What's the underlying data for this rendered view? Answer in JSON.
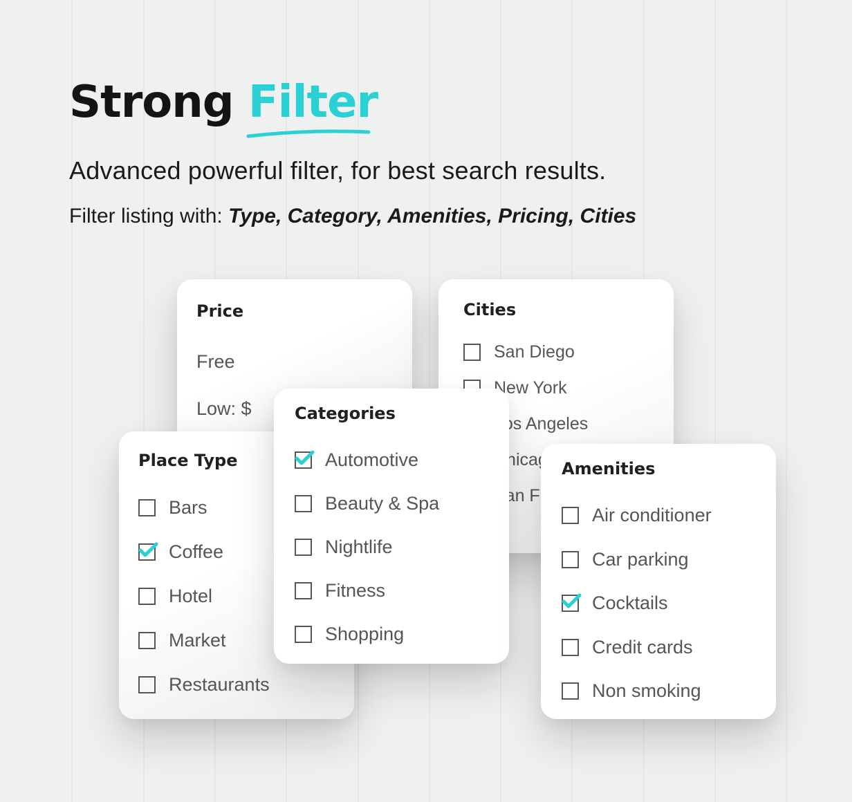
{
  "header": {
    "title_primary": "Strong",
    "title_accent": "Filter",
    "subtitle": "Advanced powerful filter, for best search results.",
    "filter_prefix": "Filter listing with: ",
    "filter_types": "Type, Category, Amenities, Pricing, Cities"
  },
  "colors": {
    "accent": "#2ad0d3",
    "background": "#eff1f0",
    "text": "#151515",
    "option_text": "#555555"
  },
  "price": {
    "title": "Price",
    "options": [
      "Free",
      "Low: $"
    ]
  },
  "cities": {
    "title": "Cities",
    "options": [
      {
        "label": "San Diego",
        "checked": false
      },
      {
        "label": "New York",
        "checked": false
      },
      {
        "label": "Los Angeles",
        "checked": false
      },
      {
        "label": "Chicago",
        "checked": false
      },
      {
        "label": "San Francisco",
        "checked": false
      }
    ]
  },
  "place_type": {
    "title": "Place Type",
    "options": [
      {
        "label": "Bars",
        "checked": false
      },
      {
        "label": "Coffee",
        "checked": true
      },
      {
        "label": "Hotel",
        "checked": false
      },
      {
        "label": "Market",
        "checked": false
      },
      {
        "label": "Restaurants",
        "checked": false
      }
    ]
  },
  "categories": {
    "title": "Categories",
    "options": [
      {
        "label": "Automotive",
        "checked": true
      },
      {
        "label": "Beauty & Spa",
        "checked": false
      },
      {
        "label": "Nightlife",
        "checked": false
      },
      {
        "label": "Fitness",
        "checked": false
      },
      {
        "label": "Shopping",
        "checked": false
      }
    ]
  },
  "amenities": {
    "title": "Amenities",
    "options": [
      {
        "label": "Air conditioner",
        "checked": false
      },
      {
        "label": "Car parking",
        "checked": false
      },
      {
        "label": "Cocktails",
        "checked": true
      },
      {
        "label": "Credit cards",
        "checked": false
      },
      {
        "label": "Non smoking",
        "checked": false
      }
    ]
  }
}
